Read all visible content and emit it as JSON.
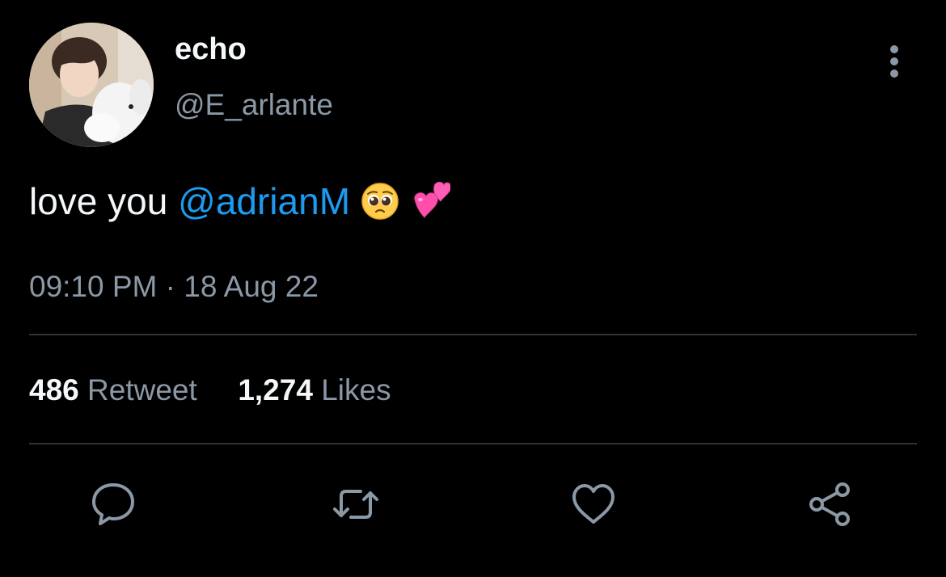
{
  "tweet": {
    "display_name": "echo",
    "handle": "@E_arlante",
    "text_before": "love you ",
    "mention": "@adrianM",
    "emojis": [
      "pleading-face",
      "two-hearts"
    ],
    "time": "09:10 PM",
    "separator": "·",
    "date": "18 Aug 22",
    "retweet_count": "486",
    "retweet_label": "Retweet",
    "like_count": "1,274",
    "like_label": "Likes"
  },
  "actions": [
    {
      "name": "reply",
      "icon": "speech-bubble-icon"
    },
    {
      "name": "retweet",
      "icon": "retweet-arrows-icon"
    },
    {
      "name": "like",
      "icon": "heart-icon"
    },
    {
      "name": "share",
      "icon": "share-nodes-icon"
    }
  ],
  "colors": {
    "background": "#000000",
    "primary_text": "#f5f8fa",
    "secondary_text": "#8b98a5",
    "link": "#1d9bf0",
    "divider": "#2f3336"
  }
}
